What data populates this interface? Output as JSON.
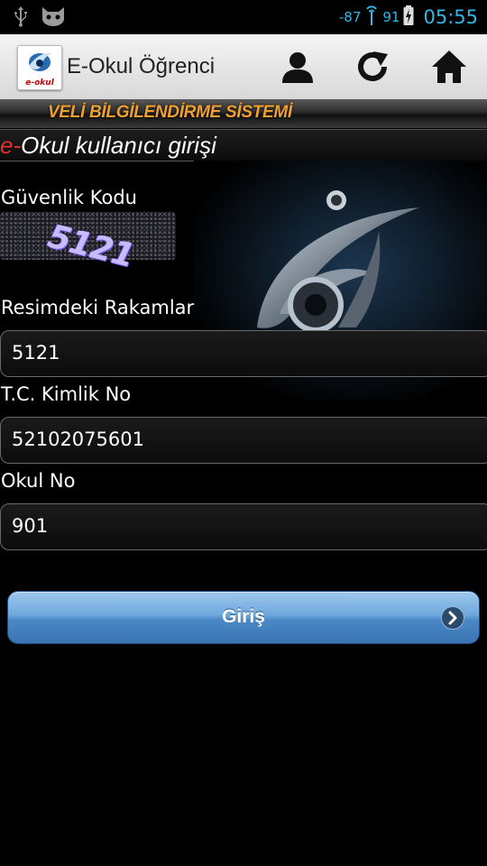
{
  "status_bar": {
    "signal_value": "-87",
    "battery_level": "91",
    "time": "05:55"
  },
  "action_bar": {
    "logo_text": "e-okul",
    "title": "E-Okul Öğrenci"
  },
  "banner": {
    "text": "VELİ BİLGİLENDİRME SİSTEMİ"
  },
  "page_header": {
    "prefix": "e-",
    "title": "Okul kullanıcı girişi"
  },
  "form": {
    "security_code_label": "Güvenlik Kodu",
    "captcha_text": "5121",
    "digits_label": "Resimdeki Rakamlar",
    "digits_value": "5121",
    "tc_label": "T.C. Kimlik No",
    "tc_value": "52102075601",
    "school_no_label": "Okul No",
    "school_no_value": "901",
    "login_label": "Giriş"
  },
  "colors": {
    "accent_blue": "#33b5e5",
    "banner_orange": "#f0a030",
    "e_red": "#e03030",
    "button_blue": "#4a88c6"
  }
}
